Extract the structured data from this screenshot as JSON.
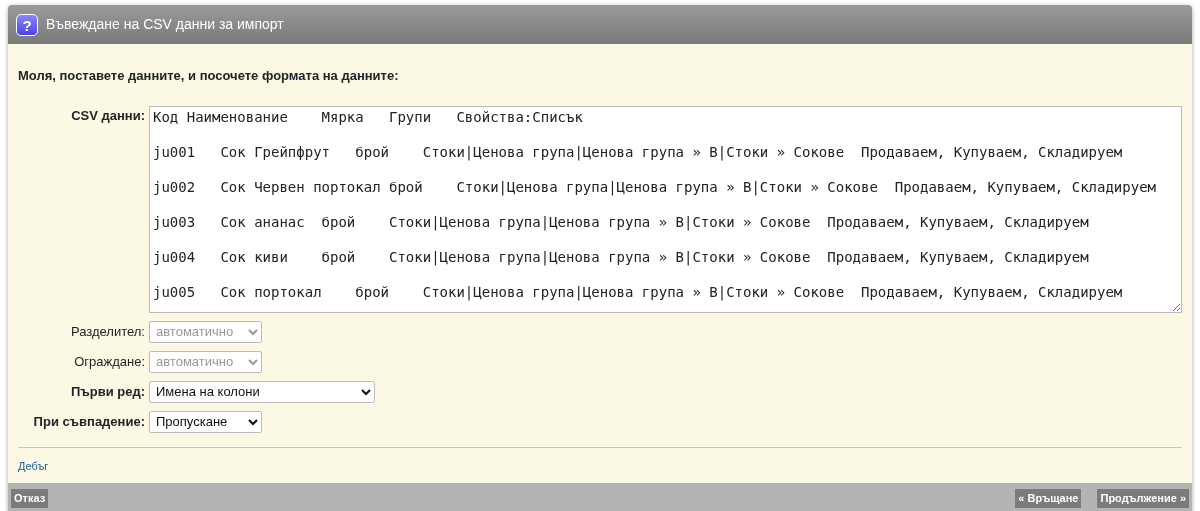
{
  "window": {
    "title": "Въвеждане на CSV данни за импорт",
    "icon": "?"
  },
  "instruction": "Моля, поставете данните, и посочете формата на данните:",
  "csv": {
    "label": "CSV данни:",
    "lines": [
      "Код Наименование    Мярка   Групи   Свойства:Списък",
      "ju001   Сок Грейпфрут   брой    Стоки|Ценова група|Ценова група » В|Стоки » Сокове  Продаваем, Купуваем, Складируем",
      "ju002   Сок Червен портокал брой    Стоки|Ценова група|Ценова група » В|Стоки » Сокове  Продаваем, Купуваем, Складируем",
      "ju003   Сок ананас  брой    Стоки|Ценова група|Ценова група » В|Стоки » Сокове  Продаваем, Купуваем, Складируем",
      "ju004   Сок киви    брой    Стоки|Ценова група|Ценова група » В|Стоки » Сокове  Продаваем, Купуваем, Складируем",
      "ju005   Сок портокал    брой    Стоки|Ценова група|Ценова група » В|Стоки » Сокове  Продаваем, Купуваем, Складируем"
    ]
  },
  "options": [
    {
      "label": "Разделител:",
      "value": "автоматично",
      "disabled": true,
      "required": false
    },
    {
      "label": "Ограждане:",
      "value": "автоматично",
      "disabled": true,
      "required": false
    },
    {
      "label": "Първи ред:",
      "value": "Имена на колони",
      "disabled": false,
      "required": true,
      "wide": true
    },
    {
      "label": "При съвпадение:",
      "value": "Пропускане",
      "disabled": false,
      "required": true,
      "wide": false
    }
  ],
  "debug_link": "Дебъг",
  "buttons": {
    "left": [
      "Отказ"
    ],
    "right": [
      "« Връщане",
      "Продължение »"
    ]
  }
}
